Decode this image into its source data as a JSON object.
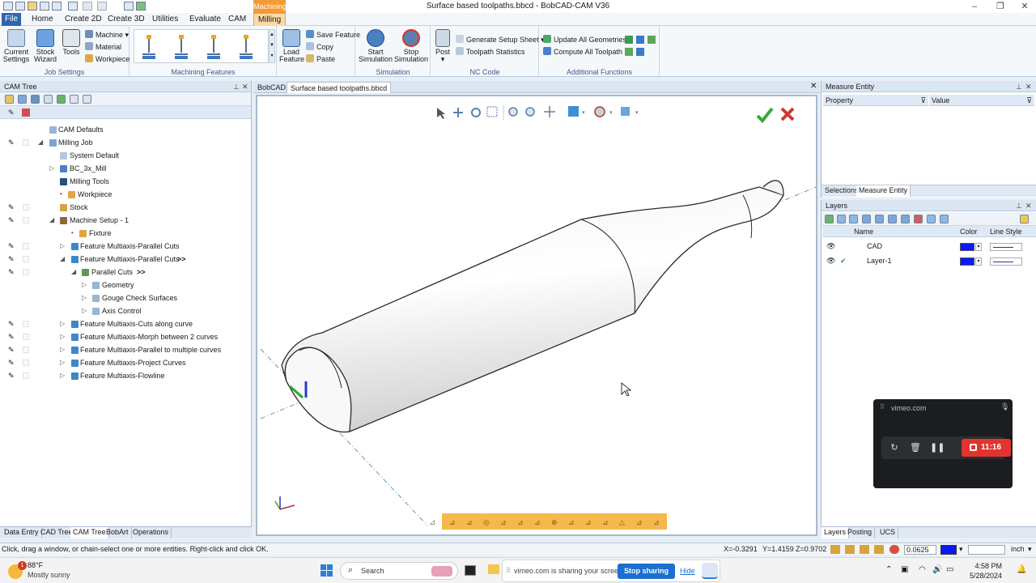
{
  "window": {
    "title": "Surface based toolpaths.bbcd - BobCAD-CAM V36"
  },
  "menu": {
    "items": [
      {
        "label": "File"
      },
      {
        "label": "Home"
      },
      {
        "label": "Create 2D"
      },
      {
        "label": "Create 3D"
      },
      {
        "label": "Utilities"
      },
      {
        "label": "Evaluate"
      },
      {
        "label": "CAM"
      },
      {
        "label": "Milling"
      }
    ],
    "context_tab": "Machining"
  },
  "ribbon": {
    "job_settings": {
      "label": "Job Settings",
      "current_settings": "Current Settings",
      "stock_wizard": "Stock Wizard",
      "tools": "Tools",
      "machine": "Machine",
      "material": "Material",
      "workpiece": "Workpiece"
    },
    "machining_features": {
      "label": "Machining Features"
    },
    "load": {
      "load_feature": "Load Feature",
      "save_feature": "Save Feature",
      "copy": "Copy",
      "paste": "Paste"
    },
    "simulation": {
      "label": "Simulation",
      "start": "Start Simulation",
      "stop": "Stop Simulation"
    },
    "nc_code": {
      "label": "NC Code",
      "post": "Post",
      "generate_setup_sheet": "Generate Setup Sheet",
      "toolpath_statistics": "Toolpath Statistics"
    },
    "additional": {
      "label": "Additional Functions",
      "update_all": "Update All Geometries",
      "compute_all": "Compute All Toolpath"
    }
  },
  "cam_tree": {
    "title": "CAM Tree",
    "rows": [
      {
        "label": "CAM Defaults"
      },
      {
        "label": "Milling Job"
      },
      {
        "label": "System Default"
      },
      {
        "label": "BC_3x_Mill"
      },
      {
        "label": "Milling Tools"
      },
      {
        "label": "Workpiece"
      },
      {
        "label": "Stock"
      },
      {
        "label": "Machine Setup - 1"
      },
      {
        "label": "Fixture"
      },
      {
        "label": "Feature Multiaxis-Parallel Cuts"
      },
      {
        "label": "Feature Multiaxis-Parallel Cuts",
        "marker": ">>"
      },
      {
        "label": "Parallel Cuts",
        "marker": ">>"
      },
      {
        "label": "Geometry"
      },
      {
        "label": "Gouge Check Surfaces"
      },
      {
        "label": "Axis Control"
      },
      {
        "label": "Feature Multiaxis-Cuts along curve"
      },
      {
        "label": "Feature Multiaxis-Morph between 2 curves"
      },
      {
        "label": "Feature Multiaxis-Parallel to multiple curves"
      },
      {
        "label": "Feature Multiaxis-Project Curves"
      },
      {
        "label": "Feature Multiaxis-Flowline"
      }
    ],
    "bottom_tabs": [
      {
        "label": "Data Entry"
      },
      {
        "label": "CAD Tree"
      },
      {
        "label": "CAM Tree"
      },
      {
        "label": "BobArt"
      },
      {
        "label": "Operations"
      }
    ]
  },
  "document_tabs": [
    {
      "label": "BobCAD1"
    },
    {
      "label": "Surface based toolpaths.bbcd"
    }
  ],
  "measure_entity": {
    "title": "Measure Entity",
    "columns": [
      "Property",
      "Value"
    ],
    "tabs": [
      {
        "label": "Selections"
      },
      {
        "label": "Measure Entity"
      }
    ]
  },
  "layers": {
    "title": "Layers",
    "columns": [
      "Name",
      "Color",
      "Line Style"
    ],
    "rows": [
      {
        "name": "CAD",
        "color": "#0a1aff",
        "active": false
      },
      {
        "name": "Layer-1",
        "color": "#0a1aff",
        "active": true
      }
    ],
    "bottom_tabs": [
      {
        "label": "Layers"
      },
      {
        "label": "Posting"
      },
      {
        "label": "UCS"
      }
    ]
  },
  "status": {
    "hint": "Click, drag a window, or chain-select one or more entities. Right-click and click OK.",
    "x": "X=-0.3291",
    "y": "Y=1.4159",
    "z": "Z=0.9702",
    "snap_value": "0.0625",
    "units": "inch"
  },
  "vimeo": {
    "domain": "vimeo.com",
    "timer": "11:16"
  },
  "taskbar": {
    "weather_temp": "88°F",
    "weather_desc": "Mostly sunny",
    "search_placeholder": "Search",
    "share_text": "vimeo.com is sharing your screen.",
    "stop_sharing": "Stop sharing",
    "hide": "Hide",
    "time": "4:58 PM",
    "date": "5/28/2024",
    "notification_count": "1"
  },
  "colors": {
    "accent": "#2e64b0",
    "context_tab": "#f39a34",
    "record_red": "#e3332f",
    "layer_blue": "#0a1aff"
  }
}
